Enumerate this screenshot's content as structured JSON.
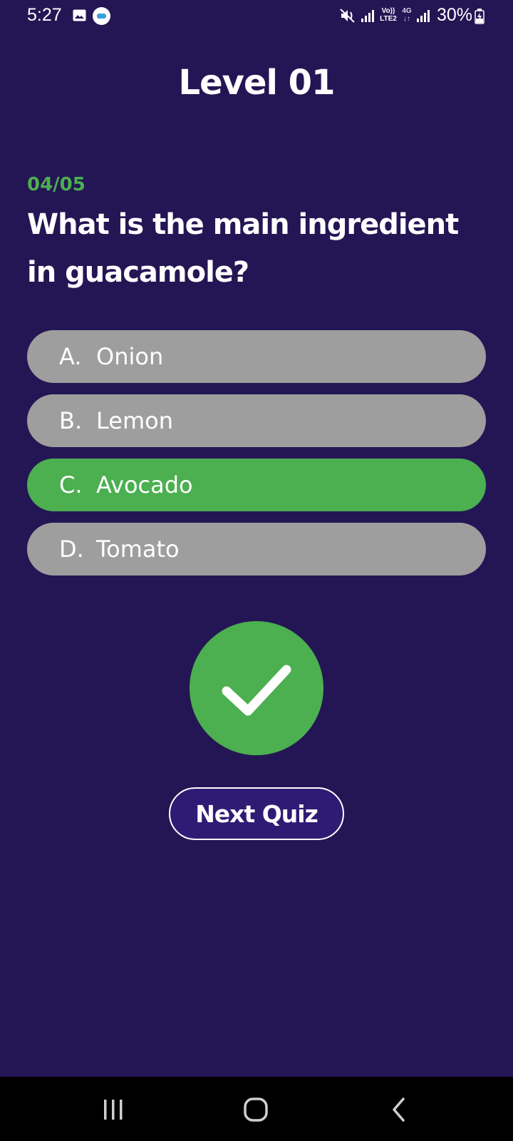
{
  "status_bar": {
    "time": "5:27",
    "battery": "30%",
    "volte_label": "Vo))\nLTE2",
    "network_label": "4G\n↓↑",
    "icons": [
      "gallery-icon",
      "app-notification-icon",
      "mute-icon",
      "signal-icon",
      "volte-icon",
      "4g-icon",
      "signal-icon",
      "battery-charging-icon"
    ]
  },
  "header": {
    "title": "Level 01"
  },
  "quiz": {
    "progress": "04/05",
    "question": "What is the main ingredient in guacamole?",
    "options": [
      {
        "letter": "A.",
        "text": "Onion",
        "state": "default"
      },
      {
        "letter": "B.",
        "text": "Lemon",
        "state": "default"
      },
      {
        "letter": "C.",
        "text": "Avocado",
        "state": "correct"
      },
      {
        "letter": "D.",
        "text": "Tomato",
        "state": "default"
      }
    ],
    "result_icon": "checkmark-icon",
    "next_button_label": "Next Quiz"
  },
  "nav_bar": {
    "icons": [
      "recents-icon",
      "home-icon",
      "back-icon"
    ]
  },
  "colors": {
    "background": "#241654",
    "accent_green": "#4caf50",
    "option_default": "#9e9e9e",
    "button_fill": "#2f1b74"
  }
}
